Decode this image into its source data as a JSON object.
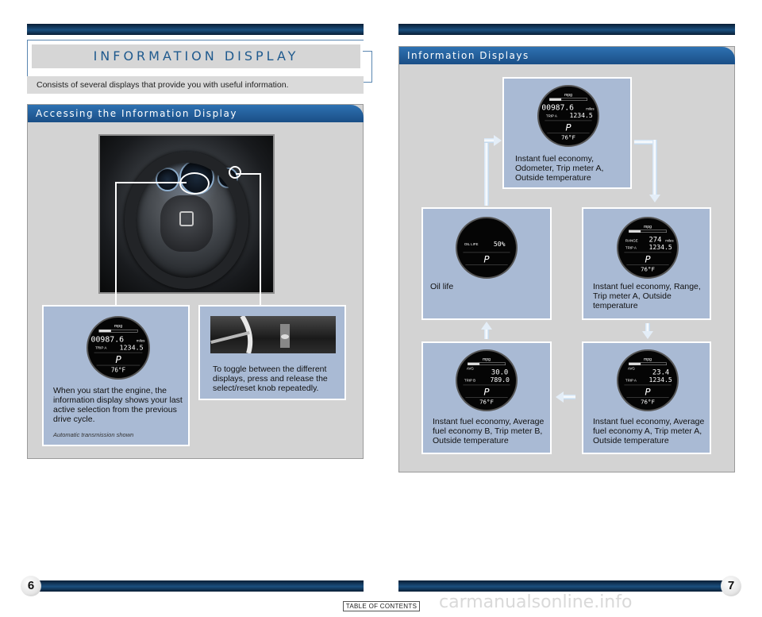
{
  "colors": {
    "accent": "#1f5a8e",
    "panel": "#d3d3d3",
    "card": "#a9bad4",
    "header_blue": "#2a6aa8"
  },
  "left_page": {
    "page_number": "6",
    "title": "INFORMATION DISPLAY",
    "subtitle": "Consists of several displays that provide you with useful information.",
    "section": {
      "heading": "Accessing the Information Display",
      "card_engine": {
        "text": "When you start the engine, the information display shows your last active selection from the previous drive cycle.",
        "note": "Automatic transmission shown"
      },
      "card_knob": {
        "text": "To toggle between the different displays, press and release the select/reset knob repeatedly."
      }
    }
  },
  "right_page": {
    "page_number": "7",
    "heading": "Information Displays",
    "items": [
      {
        "caption": "Instant fuel economy, Odometer, Trip meter A, Outside temperature"
      },
      {
        "caption": "Oil life"
      },
      {
        "caption": "Instant fuel economy, Range, Trip meter A, Outside temperature"
      },
      {
        "caption": "Instant fuel economy, Average fuel economy B, Trip meter B, Outside temperature"
      },
      {
        "caption": "Instant fuel economy, Average fuel economy A, Trip meter A, Outside temperature"
      }
    ]
  },
  "displays": {
    "mpg": "mpg",
    "scale": [
      "0",
      "30",
      "60"
    ],
    "odometer": "00987.6",
    "miles": "miles",
    "trip_a_label": "TRIP A",
    "trip_b_label": "TRIP  B",
    "trip_a_value": "1234.5",
    "trip_b_value": "789.0",
    "gear": "P",
    "temp": "76°F",
    "oil_label": "OIL LIFE",
    "oil_value": "50%",
    "range_label": "RANGE",
    "range_value": "274",
    "avg_label": "AVG",
    "avg_b_value": "30.0",
    "avg_a_value": "23.4"
  },
  "footer": {
    "toc": "TABLE OF CONTENTS",
    "watermark": "carmanualsonline.info"
  }
}
